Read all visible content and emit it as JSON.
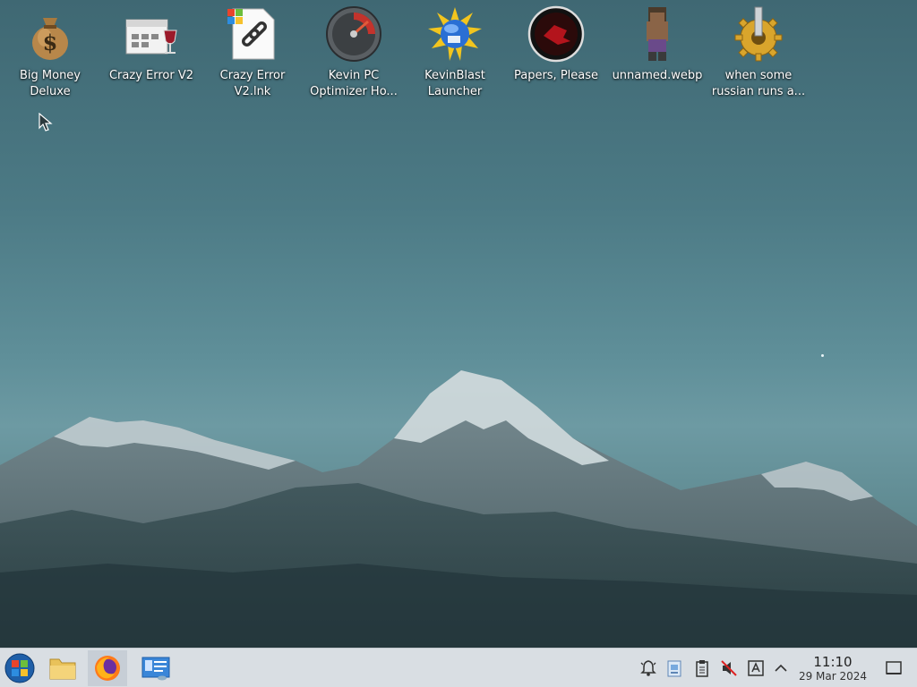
{
  "desktop": {
    "icons": [
      {
        "label": "Big Money Deluxe",
        "icon": "money-bag-icon"
      },
      {
        "label": "Crazy Error V2",
        "icon": "window-wine-icon"
      },
      {
        "label": "Crazy Error V2.lnk",
        "icon": "shortcut-link-icon"
      },
      {
        "label": "Kevin PC Optimizer Ho...",
        "icon": "speedometer-icon"
      },
      {
        "label": "KevinBlast Launcher",
        "icon": "sun-disc-icon"
      },
      {
        "label": "Papers, Please",
        "icon": "papers-please-icon"
      },
      {
        "label": "unnamed.webp",
        "icon": "pixel-character-icon"
      },
      {
        "label": "when some russian runs a...",
        "icon": "gear-icon"
      }
    ]
  },
  "taskbar": {
    "launchers": [
      {
        "name": "start-menu",
        "icon": "windows-orb-icon"
      },
      {
        "name": "file-manager",
        "icon": "folder-icon"
      },
      {
        "name": "firefox",
        "icon": "firefox-icon",
        "active": true
      },
      {
        "name": "system-settings",
        "icon": "control-panel-icon"
      }
    ],
    "tray": [
      "notifications-icon",
      "clipboard-doc-icon",
      "clipboard-icon",
      "volume-muted-icon",
      "input-method-icon",
      "expand-tray-icon"
    ],
    "clock": {
      "time": "11:10",
      "date": "29 Mar 2024"
    },
    "show_desktop": "show-desktop-icon"
  },
  "colors": {
    "taskbar_bg": "#d9dee3",
    "sky_top": "#3f6873",
    "sky_mid": "#6d9aa3"
  }
}
